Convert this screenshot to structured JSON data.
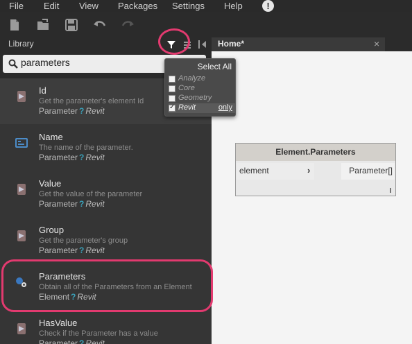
{
  "menu": {
    "file": "File",
    "edit": "Edit",
    "view": "View",
    "packages": "Packages",
    "settings": "Settings",
    "help": "Help",
    "alert": "!"
  },
  "library": {
    "title": "Library"
  },
  "search": {
    "value": "parameters"
  },
  "tab": {
    "label": "Home*",
    "close": "×"
  },
  "filter": {
    "select_all": "Select All",
    "items": [
      {
        "label": "Analyze",
        "checked": false
      },
      {
        "label": "Core",
        "checked": false
      },
      {
        "label": "Geometry",
        "checked": false
      },
      {
        "label": "Revit",
        "checked": true
      }
    ],
    "only_label": "only"
  },
  "results": [
    {
      "name": "Id",
      "description": "Get the parameter's element Id",
      "category": "Parameter",
      "library": "Revit"
    },
    {
      "name": "Name",
      "description": "The name of the parameter.",
      "category": "Parameter",
      "library": "Revit"
    },
    {
      "name": "Value",
      "description": "Get the value of the parameter",
      "category": "Parameter",
      "library": "Revit"
    },
    {
      "name": "Group",
      "description": "Get the parameter's group",
      "category": "Parameter",
      "library": "Revit"
    },
    {
      "name": "Parameters",
      "description": "Obtain all of the Parameters from an Element",
      "category": "Element",
      "library": "Revit"
    },
    {
      "name": "HasValue",
      "description": "Check if the Parameter has a value",
      "category": "Parameter",
      "library": "Revit"
    }
  ],
  "node": {
    "title": "Element.Parameters",
    "input": "element",
    "output": "Parameter[]"
  },
  "colors": {
    "highlight": "#e23a6f",
    "help_mark": "#3aa0b8"
  }
}
